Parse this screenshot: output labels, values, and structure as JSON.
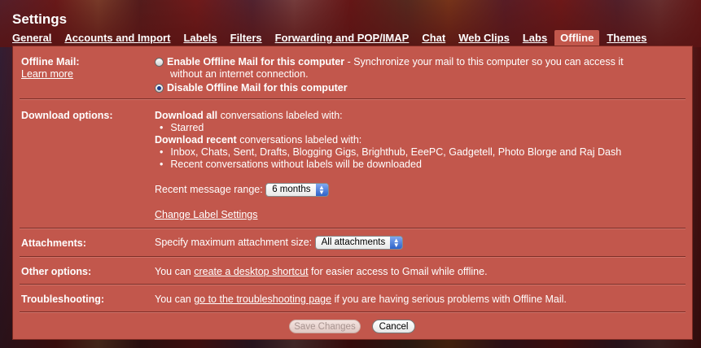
{
  "header": {
    "title": "Settings"
  },
  "tabs": [
    {
      "label": "General"
    },
    {
      "label": "Accounts and Import"
    },
    {
      "label": "Labels"
    },
    {
      "label": "Filters"
    },
    {
      "label": "Forwarding and POP/IMAP"
    },
    {
      "label": "Chat"
    },
    {
      "label": "Web Clips"
    },
    {
      "label": "Labs"
    },
    {
      "label": "Offline"
    },
    {
      "label": "Themes"
    }
  ],
  "offline_mail": {
    "label": "Offline Mail:",
    "learn_more": "Learn more",
    "enable_label": "Enable Offline Mail for this computer",
    "enable_desc_1": " - Synchronize your mail to this computer so you can access it",
    "enable_desc_2": "without an internet connection.",
    "disable_label": "Disable Offline Mail for this computer",
    "selected": "disable"
  },
  "download": {
    "label": "Download options:",
    "all_bold": "Download all",
    "all_rest": " conversations labeled with:",
    "all_items": [
      "Starred"
    ],
    "recent_bold": "Download recent",
    "recent_rest": " conversations labeled with:",
    "recent_items": [
      "Inbox, Chats, Sent, Drafts, Blogging Gigs, Brighthub, EeePC, Gadgetell, Photo Blorge and Raj Dash",
      "Recent conversations without labels will be downloaded"
    ],
    "range_label": "Recent message range:",
    "range_value": "6 months",
    "change_link": "Change Label Settings"
  },
  "attachments": {
    "label": "Attachments:",
    "text": "Specify maximum attachment size:",
    "value": "All attachments"
  },
  "other": {
    "label": "Other options:",
    "pre": "You can ",
    "link": "create a desktop shortcut",
    "post": " for easier access to Gmail while offline."
  },
  "troubleshooting": {
    "label": "Troubleshooting:",
    "pre": "You can ",
    "link": "go to the troubleshooting page",
    "post": " if you are having serious problems with Offline Mail."
  },
  "buttons": {
    "save": "Save Changes",
    "cancel": "Cancel"
  },
  "colors": {
    "panel": "#c2574c",
    "active_tab": "#c2574c",
    "select_accent": "#2f63c8"
  }
}
